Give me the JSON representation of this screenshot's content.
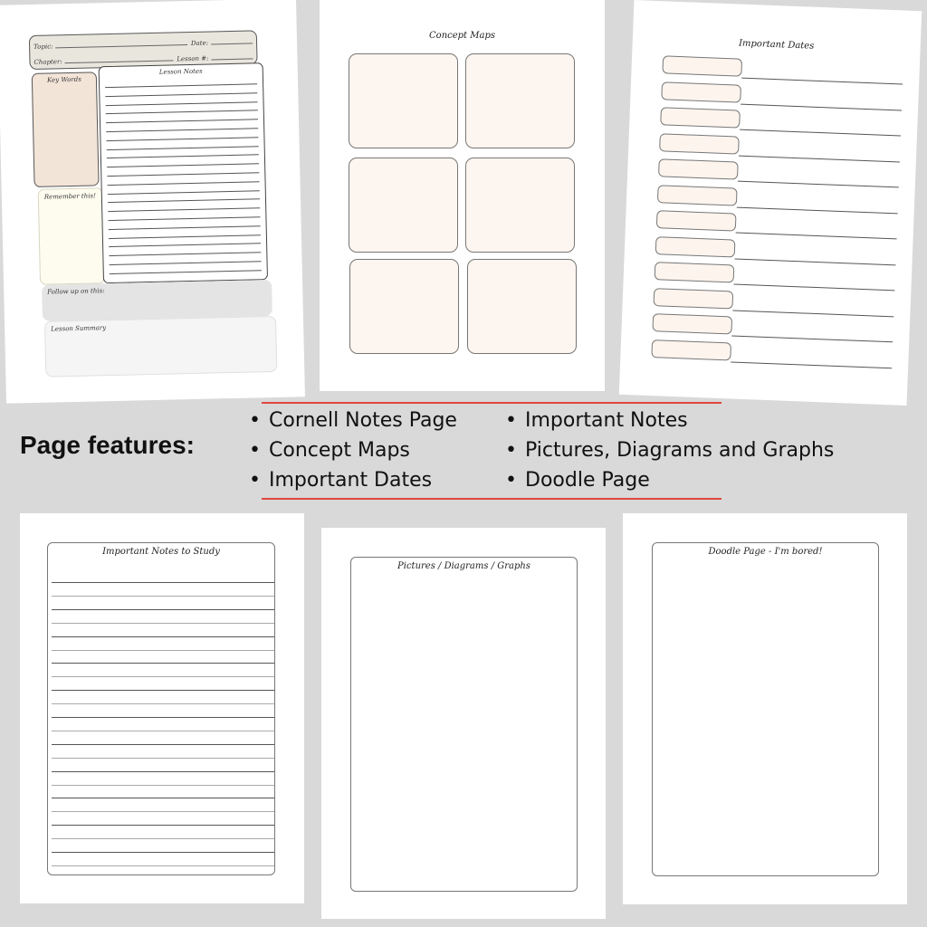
{
  "colors": {
    "background": "#d9d9d9",
    "accent_rule": "#e0463e",
    "peach_fill": "#fdf5ef",
    "keywords_fill": "#f3e4d8",
    "remember_fill": "#fdfcef",
    "header_fill": "#e9e7dd",
    "followup_fill": "#e4e4e4",
    "summary_fill": "#f5f5f5"
  },
  "pages": {
    "cornell": {
      "topic_label": "Topic:",
      "date_label": "Date:",
      "chapter_label": "Chapter:",
      "lesson_label": "Lesson #:",
      "key_words_label": "Key Words",
      "lesson_notes_label": "Lesson Notes",
      "remember_label": "Remember this!",
      "follow_up_label": "Follow up on this:",
      "summary_label": "Lesson Summary",
      "note_line_count": 22
    },
    "concept_maps": {
      "title": "Concept Maps",
      "box_count": 6
    },
    "important_dates": {
      "title": "Important Dates",
      "row_count": 12
    },
    "important_notes": {
      "title": "Important Notes to Study",
      "line_count": 22
    },
    "pictures": {
      "title": "Pictures / Diagrams / Graphs"
    },
    "doodle": {
      "title": "Doodle Page - I'm bored!"
    }
  },
  "features": {
    "heading": "Page features:",
    "left_items": [
      "Cornell Notes Page",
      "Concept Maps",
      "Important Dates"
    ],
    "right_items": [
      "Important Notes",
      "Pictures, Diagrams and Graphs",
      "Doodle Page"
    ]
  }
}
